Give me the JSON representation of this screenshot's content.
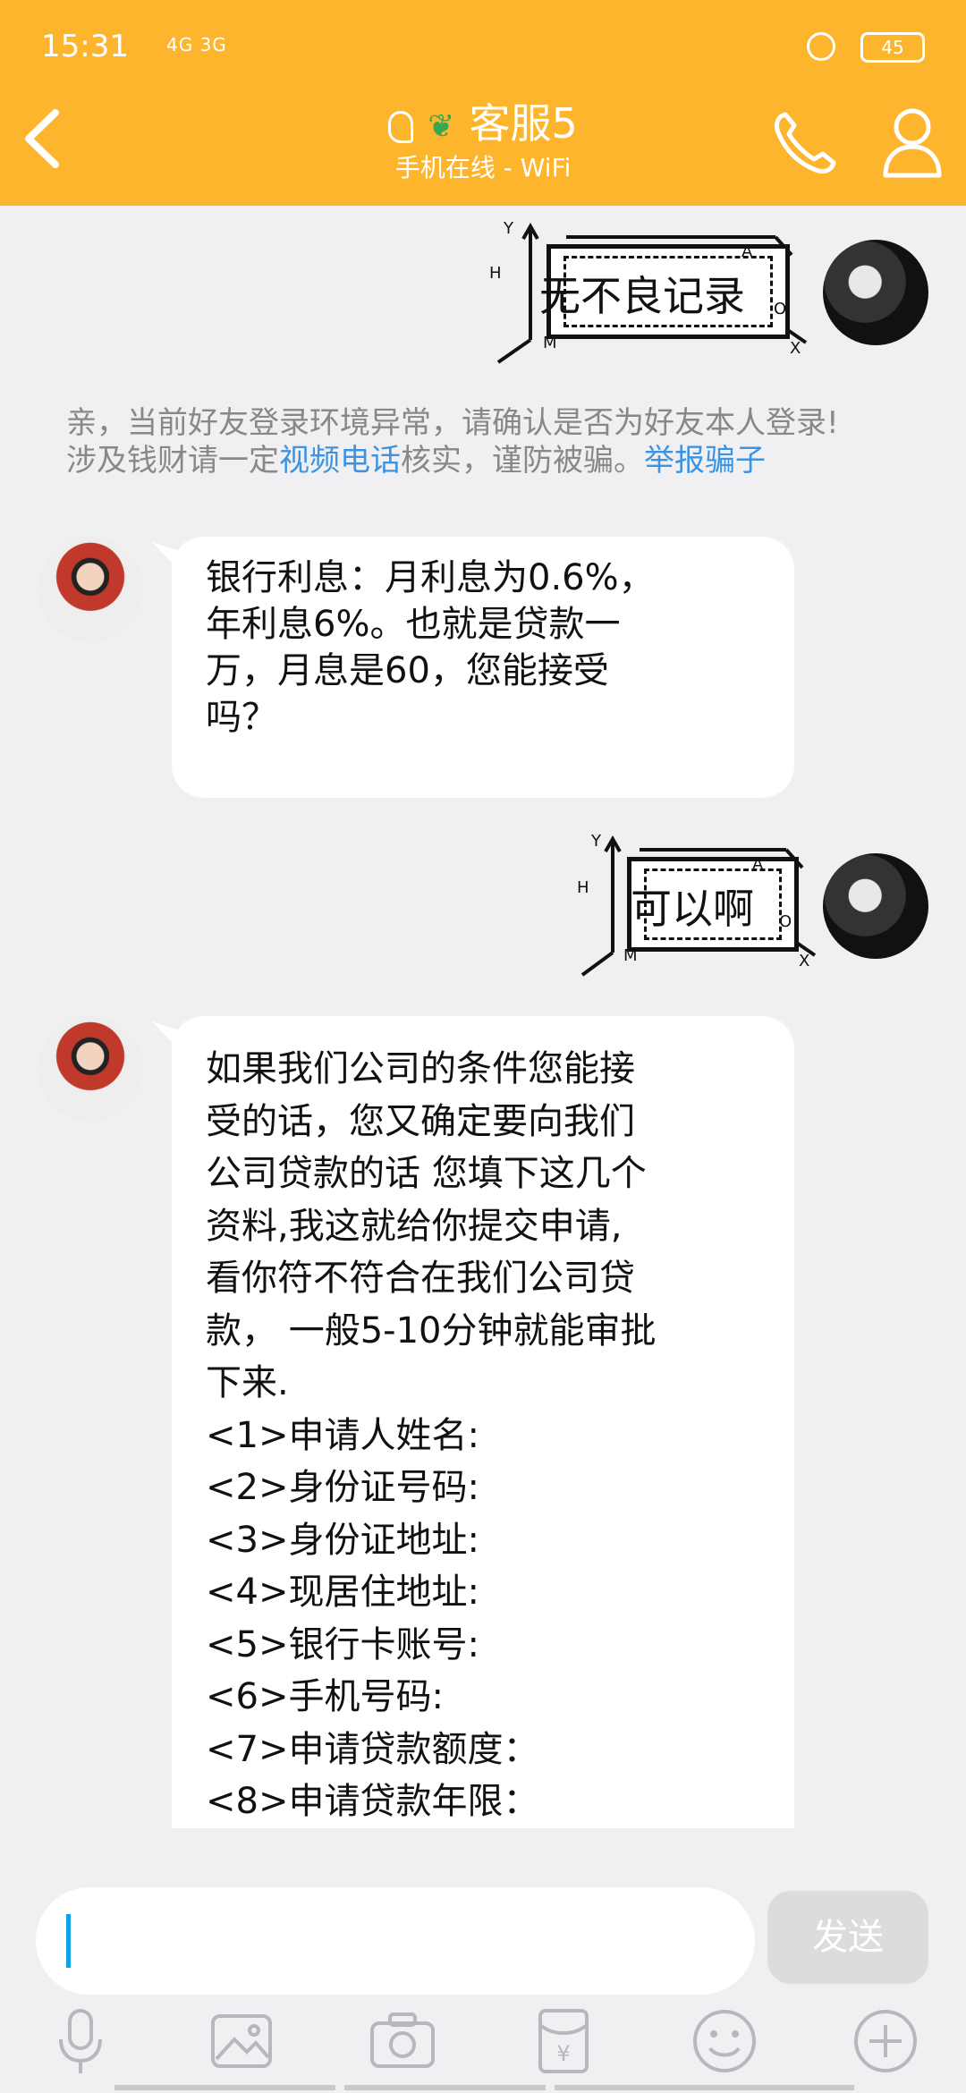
{
  "status_bar": {
    "time": "15:31",
    "signal": "4G 3G",
    "battery": "45"
  },
  "header": {
    "contact_name": "客服5",
    "subtitle": "手机在线 - WiFi",
    "back_icon": "chevron-left-icon",
    "call_icon": "phone-icon",
    "profile_icon": "person-icon"
  },
  "messages": [
    {
      "from": "me",
      "type": "sticker",
      "text": "无不良记录"
    },
    {
      "from": "system",
      "type": "notice",
      "line1": "亲，当前好友登录环境异常，请确认是否为好友本人登录!",
      "line2_prefix": "涉及钱财请一定",
      "line2_link": "视频电话",
      "line2_mid": "核实，谨防被骗。",
      "line2_report": "举报骗子"
    },
    {
      "from": "agent",
      "type": "text",
      "lines": [
        "银行利息：月利息为0.6%，",
        "年利息6%。也就是贷款一",
        "万，月息是60，您能接受",
        "吗？"
      ]
    },
    {
      "from": "me",
      "type": "sticker",
      "text": "可以啊"
    },
    {
      "from": "agent",
      "type": "text",
      "lines": [
        "如果我们公司的条件您能接",
        "受的话，您又确定要向我们",
        "公司贷款的话 您填下这几个",
        "资料,我这就给你提交申请,",
        "看你符不符合在我们公司贷",
        "款， 一般5-10分钟就能审批",
        "下来.",
        "<1>申请人姓名:",
        "<2>身份证号码:",
        "<3>身份证地址:",
        "<4>现居住地址:",
        "<5>银行卡账号:",
        "<6>手机号码:",
        "<7>申请贷款额度：",
        "<8>申请贷款年限："
      ]
    }
  ],
  "sticker_axis": {
    "y": "Y",
    "h": "H",
    "a": "A",
    "o": "O",
    "m": "M",
    "x": "X"
  },
  "input": {
    "value": ""
  },
  "send_label": "发送",
  "toolbar_icons": [
    "microphone-icon",
    "image-icon",
    "camera-icon",
    "red-packet-icon",
    "emoji-icon",
    "plus-icon"
  ],
  "colors": {
    "header": "#fdb52d",
    "link": "#3d93e0",
    "caret": "#0fa0e6",
    "background": "#f0f0f2"
  }
}
